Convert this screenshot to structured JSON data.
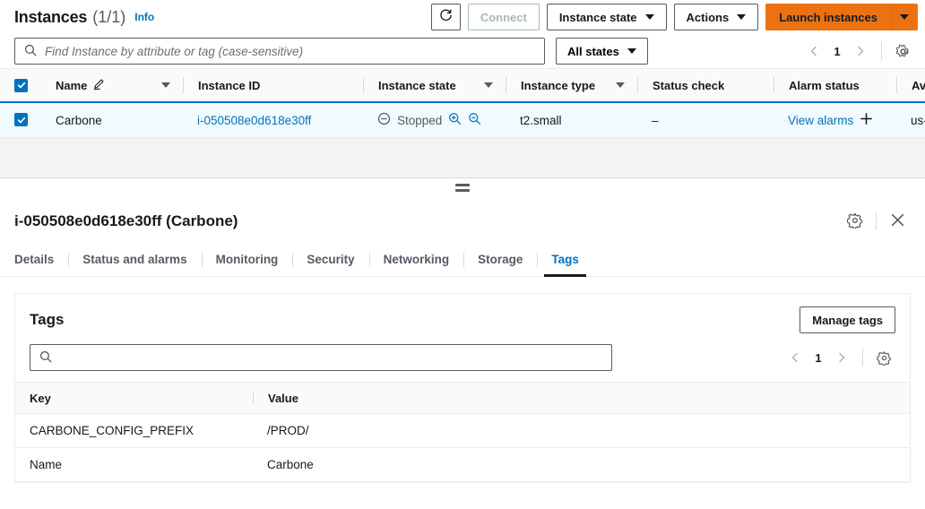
{
  "instances_panel": {
    "title": "Instances",
    "count": "(1/1)",
    "info_label": "Info",
    "toolbar": {
      "refresh_icon": "refresh-icon",
      "connect_label": "Connect",
      "instance_state_label": "Instance state",
      "actions_label": "Actions",
      "launch_label": "Launch instances",
      "launch_caret_icon": "chevron-down-icon"
    },
    "filter": {
      "search_placeholder": "Find Instance by attribute or tag (case-sensitive)",
      "search_value": "",
      "search_icon": "search-icon",
      "states_label": "All states",
      "page_number": "1",
      "prev_icon": "chevron-left-icon",
      "next_icon": "chevron-right-icon",
      "settings_icon": "gear-icon"
    },
    "table": {
      "columns": [
        "Name",
        "Instance ID",
        "Instance state",
        "Instance type",
        "Status check",
        "Alarm status",
        "Av"
      ],
      "rows": [
        {
          "selected": true,
          "name": "Carbone",
          "instance_id": "i-050508e0d618e30ff",
          "instance_state": "Stopped",
          "instance_state_icon": "stopped-circle-icon",
          "instance_type": "t2.small",
          "status_check": "–",
          "alarm_status": "View alarms",
          "alarm_add_icon": "plus-icon",
          "availability_zone": "us-"
        }
      ]
    }
  },
  "detail_panel": {
    "title": "i-050508e0d618e30ff (Carbone)",
    "settings_icon": "gear-icon",
    "close_icon": "close-icon",
    "splitter_icon": "drag-handle-icon",
    "tabs": [
      {
        "label": "Details",
        "active": false
      },
      {
        "label": "Status and alarms",
        "active": false
      },
      {
        "label": "Monitoring",
        "active": false
      },
      {
        "label": "Security",
        "active": false
      },
      {
        "label": "Networking",
        "active": false
      },
      {
        "label": "Storage",
        "active": false
      },
      {
        "label": "Tags",
        "active": true
      }
    ],
    "tags_section": {
      "title": "Tags",
      "manage_label": "Manage tags",
      "search_placeholder": "",
      "search_value": "",
      "search_icon": "search-icon",
      "page_number": "1",
      "prev_icon": "chevron-left-icon",
      "next_icon": "chevron-right-icon",
      "settings_icon": "gear-icon",
      "columns": [
        "Key",
        "Value"
      ],
      "rows": [
        {
          "key": "CARBONE_CONFIG_PREFIX",
          "value": "/PROD/"
        },
        {
          "key": "Name",
          "value": "Carbone"
        }
      ]
    }
  },
  "colors": {
    "accent_orange": "#ec7211",
    "link_blue": "#0073bb",
    "selected_row": "#f1faff",
    "border_gray": "#eaeded"
  }
}
